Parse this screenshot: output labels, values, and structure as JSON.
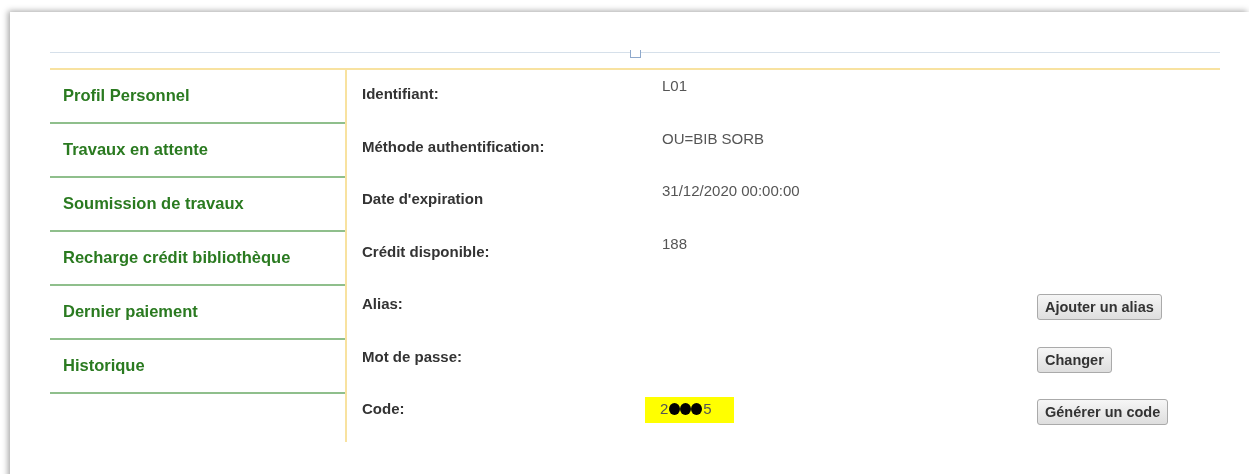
{
  "sidebar": {
    "items": [
      {
        "label": "Profil Personnel"
      },
      {
        "label": "Travaux en attente"
      },
      {
        "label": "Soumission de travaux"
      },
      {
        "label": "Recharge crédit bibliothèque"
      },
      {
        "label": "Dernier paiement"
      },
      {
        "label": "Historique"
      }
    ]
  },
  "fields": [
    {
      "label": "Identifiant:",
      "value": "L01"
    },
    {
      "label": "Méthode authentification:",
      "value": "OU=BIB SORB"
    },
    {
      "label": "Date d'expiration",
      "value": "31/12/2020 00:00:00"
    },
    {
      "label": "Crédit disponible:",
      "value": "188"
    },
    {
      "label": "Alias:",
      "button": "Ajouter un alias"
    },
    {
      "label": "Mot de passe:",
      "button": "Changer"
    },
    {
      "label": "Code:",
      "value_start": "2",
      "value_end": "5",
      "redacted": true,
      "highlighted": true,
      "button": "Générer un code"
    }
  ]
}
